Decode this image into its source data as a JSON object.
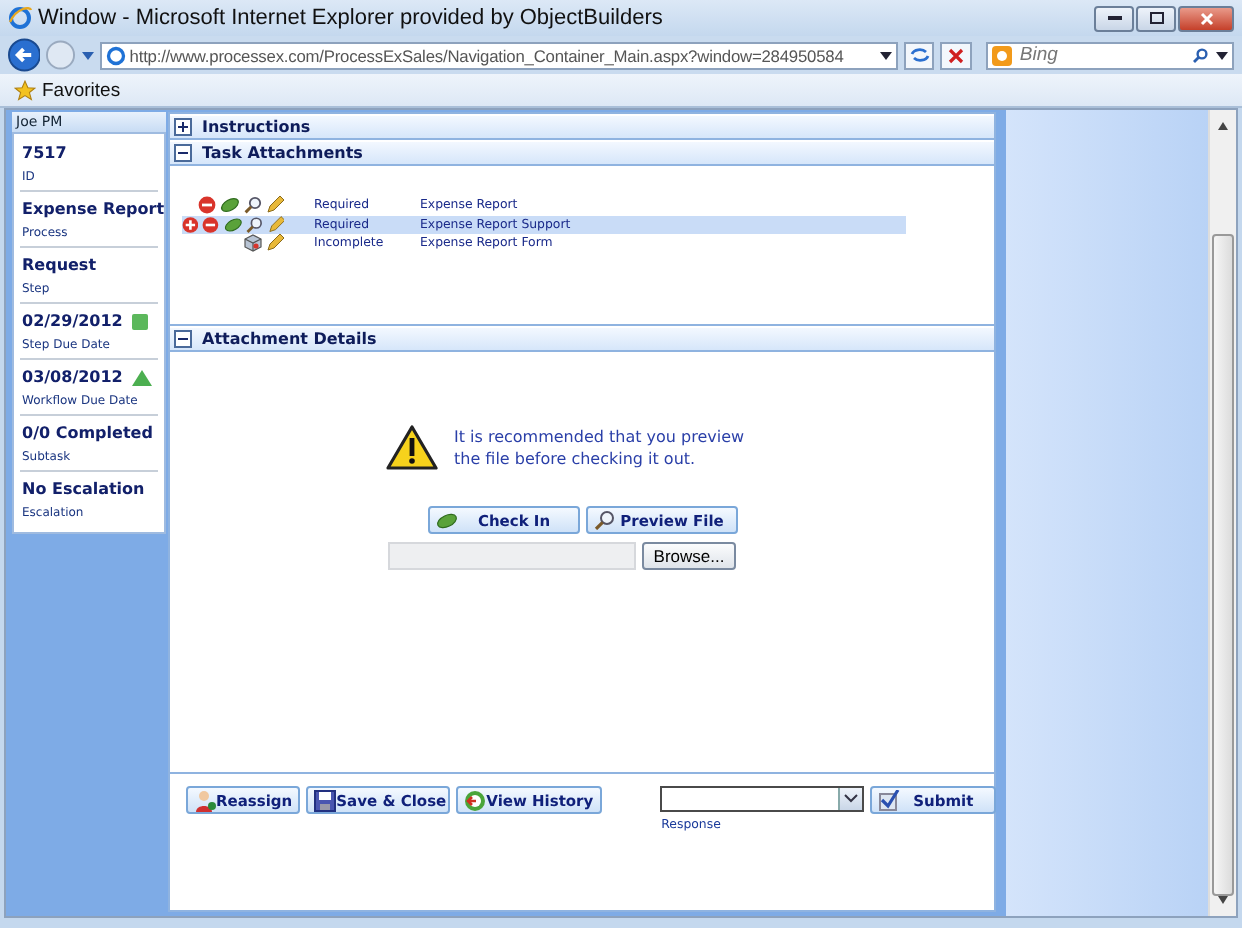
{
  "window": {
    "title": "Window - Microsoft Internet Explorer provided by ObjectBuilders"
  },
  "browser": {
    "address": "http://www.processex.com/ProcessExSales/Navigation_Container_Main.aspx?window=284950584",
    "search_placeholder": "Bing",
    "favorites": "Favorites"
  },
  "sidebar": {
    "user": "Joe PM",
    "items": [
      {
        "value": "7517",
        "label": "ID"
      },
      {
        "value": "Expense Report",
        "label": "Process"
      },
      {
        "value": "Request",
        "label": "Step"
      },
      {
        "value": "02/29/2012",
        "label": "Step Due Date",
        "indicator": {
          "kind": "square",
          "color": "#5cb85c"
        }
      },
      {
        "value": "03/08/2012",
        "label": "Workflow Due Date",
        "indicator": {
          "kind": "triangle",
          "color": "#4caf50"
        }
      },
      {
        "value": "0/0 Completed",
        "label": "Subtask"
      },
      {
        "value": "No Escalation",
        "label": "Escalation"
      }
    ]
  },
  "instructions": {
    "title": "Instructions",
    "expanded": false
  },
  "task_attachments": {
    "title": "Task Attachments",
    "expanded": true,
    "rows": [
      {
        "actions": {
          "add": false,
          "remove": true,
          "check_in": true,
          "preview": true,
          "package": false,
          "edit": true
        },
        "status": "Required",
        "name": "Expense Report",
        "selected": false
      },
      {
        "actions": {
          "add": true,
          "remove": true,
          "check_in": true,
          "preview": true,
          "package": false,
          "edit": true
        },
        "status": "Required",
        "name": "Expense Report Support",
        "selected": true
      },
      {
        "actions": {
          "add": false,
          "remove": false,
          "check_in": false,
          "preview": false,
          "package": true,
          "edit": true
        },
        "status": "Incomplete",
        "name": "Expense Report Form",
        "selected": false
      }
    ]
  },
  "attachment_details": {
    "title": "Attachment Details",
    "expanded": true,
    "message": "It is recommended that you preview the file before checking it out.",
    "buttons": [
      "Check In",
      "Preview File"
    ],
    "browse": "Browse..."
  },
  "footer": {
    "buttons": [
      "Reassign",
      "Save & Close",
      "View History"
    ],
    "response_label": "Response",
    "submit": "Submit"
  }
}
